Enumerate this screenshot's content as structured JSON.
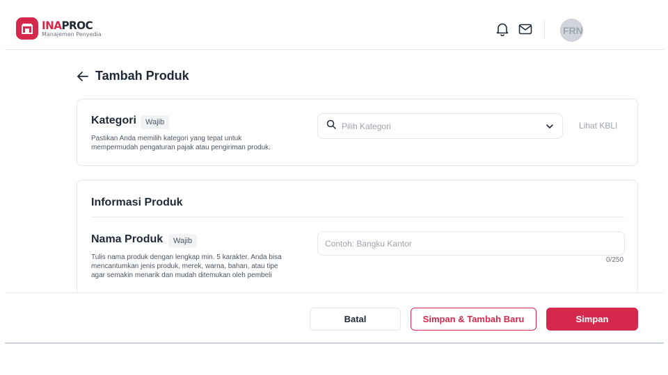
{
  "header": {
    "logo_brand_ina": "INA",
    "logo_brand_proc": "PROC",
    "logo_subtitle": "Manajemen Penyedia",
    "avatar_initials": "FRN"
  },
  "page": {
    "title": "Tambah Produk"
  },
  "kategori": {
    "title": "Kategori",
    "badge": "Wajib",
    "description": "Pastikan Anda memilih kategori yang tepat untuk mempermudah pengaturan pajak atau pengiriman produk.",
    "select_placeholder": "Pilih Kategori",
    "link_label": "Lihat KBLI"
  },
  "informasi": {
    "title": "Informasi Produk",
    "nama_produk": {
      "label": "Nama Produk",
      "badge": "Wajib",
      "description": "Tulis nama produk dengan lengkap min. 5 karakter. Anda bisa mencantumkan jenis produk, merek, warna, bahan, atau tipe agar semakin menarik dan mudah ditemukan oleh pembeli",
      "value": "",
      "placeholder": "Contoh: Bangku Kantor",
      "counter": "0/250"
    }
  },
  "footer": {
    "batal_label": "Batal",
    "simpan_baru_label": "Simpan & Tambah Baru",
    "simpan_label": "Simpan"
  },
  "colors": {
    "brand": "#d4294c",
    "border": "#e5e7eb",
    "text": "#1f2937",
    "muted": "#9ca3af"
  },
  "icons": [
    "logo-icon",
    "bell-icon",
    "mail-icon",
    "back-arrow-icon",
    "search-icon",
    "chevron-down-icon"
  ]
}
